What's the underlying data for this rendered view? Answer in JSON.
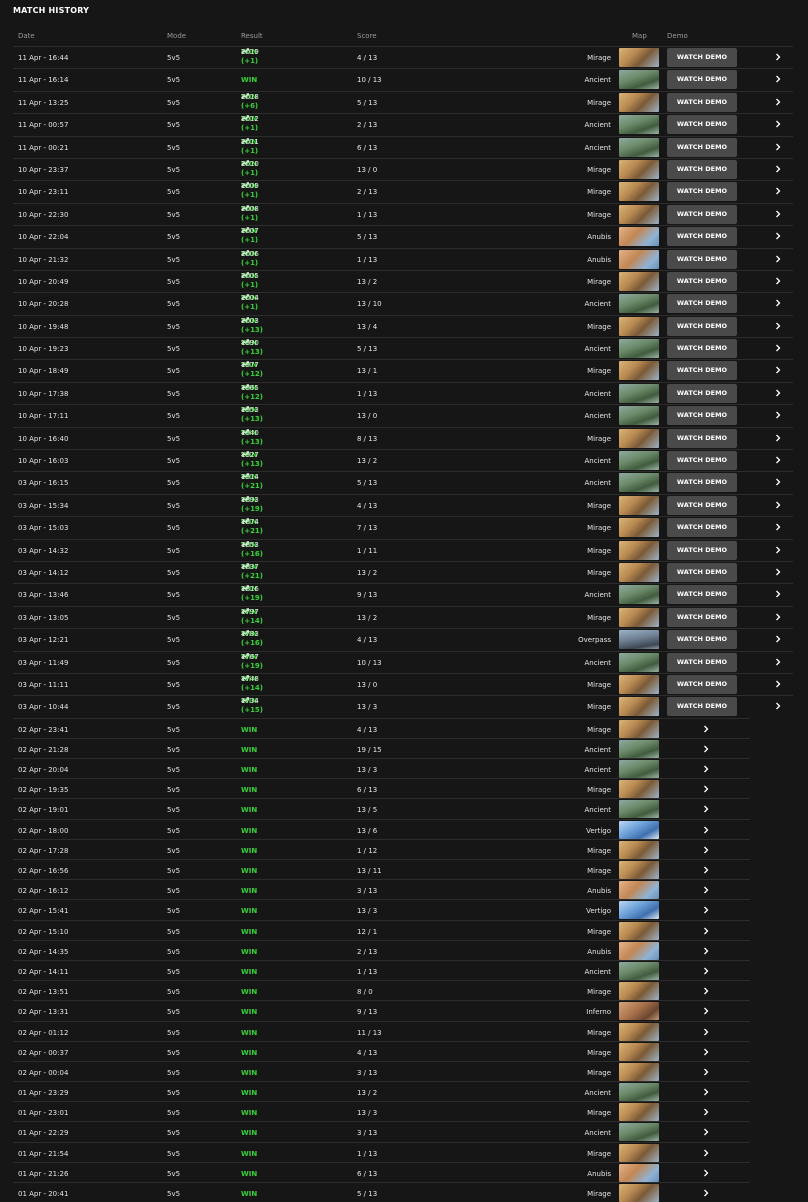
{
  "title": "MATCH HISTORY",
  "columns": {
    "date": "Date",
    "mode": "Mode",
    "result": "Result",
    "score": "Score",
    "map": "Map",
    "demo": "Demo"
  },
  "demo_label": "WATCH DEMO",
  "colors": {
    "win": "#3ad13a",
    "button_bg": "#4a4a4a",
    "background": "#161616"
  },
  "icons": {
    "elo": "trend-up-icon",
    "arrow": "chevron-right-icon"
  },
  "matches": [
    {
      "date": "11 Apr - 16:44",
      "mode": "5v5",
      "result": "WIN (+1)",
      "elo": "2019",
      "score": "4 / 13",
      "map": "Mirage",
      "demo": true
    },
    {
      "date": "11 Apr - 16:14",
      "mode": "5v5",
      "result": "WIN",
      "elo": "",
      "score": "10 / 13",
      "map": "Ancient",
      "demo": true
    },
    {
      "date": "11 Apr - 13:25",
      "mode": "5v5",
      "result": "WIN (+6)",
      "elo": "2018",
      "score": "5 / 13",
      "map": "Mirage",
      "demo": true
    },
    {
      "date": "11 Apr - 00:57",
      "mode": "5v5",
      "result": "WIN (+1)",
      "elo": "2012",
      "score": "2 / 13",
      "map": "Ancient",
      "demo": true
    },
    {
      "date": "11 Apr - 00:21",
      "mode": "5v5",
      "result": "WIN (+1)",
      "elo": "2011",
      "score": "6 / 13",
      "map": "Ancient",
      "demo": true
    },
    {
      "date": "10 Apr - 23:37",
      "mode": "5v5",
      "result": "WIN (+1)",
      "elo": "2010",
      "score": "13 / 0",
      "map": "Mirage",
      "demo": true
    },
    {
      "date": "10 Apr - 23:11",
      "mode": "5v5",
      "result": "WIN (+1)",
      "elo": "2009",
      "score": "2 / 13",
      "map": "Mirage",
      "demo": true
    },
    {
      "date": "10 Apr - 22:30",
      "mode": "5v5",
      "result": "WIN (+1)",
      "elo": "2008",
      "score": "1 / 13",
      "map": "Mirage",
      "demo": true
    },
    {
      "date": "10 Apr - 22:04",
      "mode": "5v5",
      "result": "WIN (+1)",
      "elo": "2007",
      "score": "5 / 13",
      "map": "Anubis",
      "demo": true
    },
    {
      "date": "10 Apr - 21:32",
      "mode": "5v5",
      "result": "WIN (+1)",
      "elo": "2006",
      "score": "1 / 13",
      "map": "Anubis",
      "demo": true
    },
    {
      "date": "10 Apr - 20:49",
      "mode": "5v5",
      "result": "WIN (+1)",
      "elo": "2005",
      "score": "13 / 2",
      "map": "Mirage",
      "demo": true
    },
    {
      "date": "10 Apr - 20:28",
      "mode": "5v5",
      "result": "WIN (+1)",
      "elo": "2004",
      "score": "13 / 10",
      "map": "Ancient",
      "demo": true
    },
    {
      "date": "10 Apr - 19:48",
      "mode": "5v5",
      "result": "WIN (+13)",
      "elo": "2003",
      "score": "13 / 4",
      "map": "Mirage",
      "demo": true
    },
    {
      "date": "10 Apr - 19:23",
      "mode": "5v5",
      "result": "WIN (+13)",
      "elo": "1990",
      "score": "5 / 13",
      "map": "Ancient",
      "demo": true
    },
    {
      "date": "10 Apr - 18:49",
      "mode": "5v5",
      "result": "WIN (+12)",
      "elo": "1977",
      "score": "13 / 1",
      "map": "Mirage",
      "demo": true
    },
    {
      "date": "10 Apr - 17:38",
      "mode": "5v5",
      "result": "WIN (+12)",
      "elo": "1965",
      "score": "1 / 13",
      "map": "Ancient",
      "demo": true
    },
    {
      "date": "10 Apr - 17:11",
      "mode": "5v5",
      "result": "WIN (+13)",
      "elo": "1953",
      "score": "13 / 0",
      "map": "Ancient",
      "demo": true
    },
    {
      "date": "10 Apr - 16:40",
      "mode": "5v5",
      "result": "WIN (+13)",
      "elo": "1940",
      "score": "8 / 13",
      "map": "Mirage",
      "demo": true
    },
    {
      "date": "10 Apr - 16:03",
      "mode": "5v5",
      "result": "WIN (+13)",
      "elo": "1927",
      "score": "13 / 2",
      "map": "Ancient",
      "demo": true
    },
    {
      "date": "03 Apr - 16:15",
      "mode": "5v5",
      "result": "WIN (+21)",
      "elo": "1914",
      "score": "5 / 13",
      "map": "Ancient",
      "demo": true
    },
    {
      "date": "03 Apr - 15:34",
      "mode": "5v5",
      "result": "WIN (+19)",
      "elo": "1893",
      "score": "4 / 13",
      "map": "Mirage",
      "demo": true
    },
    {
      "date": "03 Apr - 15:03",
      "mode": "5v5",
      "result": "WIN (+21)",
      "elo": "1874",
      "score": "7 / 13",
      "map": "Mirage",
      "demo": true
    },
    {
      "date": "03 Apr - 14:32",
      "mode": "5v5",
      "result": "WIN (+16)",
      "elo": "1853",
      "score": "1 / 11",
      "map": "Mirage",
      "demo": true
    },
    {
      "date": "03 Apr - 14:12",
      "mode": "5v5",
      "result": "WIN (+21)",
      "elo": "1837",
      "score": "13 / 2",
      "map": "Mirage",
      "demo": true
    },
    {
      "date": "03 Apr - 13:46",
      "mode": "5v5",
      "result": "WIN (+19)",
      "elo": "1816",
      "score": "9 / 13",
      "map": "Ancient",
      "demo": true
    },
    {
      "date": "03 Apr - 13:05",
      "mode": "5v5",
      "result": "WIN (+14)",
      "elo": "1797",
      "score": "13 / 2",
      "map": "Mirage",
      "demo": true
    },
    {
      "date": "03 Apr - 12:21",
      "mode": "5v5",
      "result": "WIN (+16)",
      "elo": "1783",
      "score": "4 / 13",
      "map": "Overpass",
      "demo": true
    },
    {
      "date": "03 Apr - 11:49",
      "mode": "5v5",
      "result": "WIN (+19)",
      "elo": "1767",
      "score": "10 / 13",
      "map": "Ancient",
      "demo": true
    },
    {
      "date": "03 Apr - 11:11",
      "mode": "5v5",
      "result": "WIN (+14)",
      "elo": "1748",
      "score": "13 / 0",
      "map": "Mirage",
      "demo": true
    },
    {
      "date": "03 Apr - 10:44",
      "mode": "5v5",
      "result": "WIN (+15)",
      "elo": "1734",
      "score": "13 / 3",
      "map": "Mirage",
      "demo": true
    },
    {
      "date": "02 Apr - 23:41",
      "mode": "5v5",
      "result": "WIN",
      "elo": "",
      "score": "4 / 13",
      "map": "Mirage",
      "demo": false
    },
    {
      "date": "02 Apr - 21:28",
      "mode": "5v5",
      "result": "WIN",
      "elo": "",
      "score": "19 / 15",
      "map": "Ancient",
      "demo": false
    },
    {
      "date": "02 Apr - 20:04",
      "mode": "5v5",
      "result": "WIN",
      "elo": "",
      "score": "13 / 3",
      "map": "Ancient",
      "demo": false
    },
    {
      "date": "02 Apr - 19:35",
      "mode": "5v5",
      "result": "WIN",
      "elo": "",
      "score": "6 / 13",
      "map": "Mirage",
      "demo": false
    },
    {
      "date": "02 Apr - 19:01",
      "mode": "5v5",
      "result": "WIN",
      "elo": "",
      "score": "13 / 5",
      "map": "Ancient",
      "demo": false
    },
    {
      "date": "02 Apr - 18:00",
      "mode": "5v5",
      "result": "WIN",
      "elo": "",
      "score": "13 / 6",
      "map": "Vertigo",
      "demo": false
    },
    {
      "date": "02 Apr - 17:28",
      "mode": "5v5",
      "result": "WIN",
      "elo": "",
      "score": "1 / 12",
      "map": "Mirage",
      "demo": false
    },
    {
      "date": "02 Apr - 16:56",
      "mode": "5v5",
      "result": "WIN",
      "elo": "",
      "score": "13 / 11",
      "map": "Mirage",
      "demo": false
    },
    {
      "date": "02 Apr - 16:12",
      "mode": "5v5",
      "result": "WIN",
      "elo": "",
      "score": "3 / 13",
      "map": "Anubis",
      "demo": false
    },
    {
      "date": "02 Apr - 15:41",
      "mode": "5v5",
      "result": "WIN",
      "elo": "",
      "score": "13 / 3",
      "map": "Vertigo",
      "demo": false
    },
    {
      "date": "02 Apr - 15:10",
      "mode": "5v5",
      "result": "WIN",
      "elo": "",
      "score": "12 / 1",
      "map": "Mirage",
      "demo": false
    },
    {
      "date": "02 Apr - 14:35",
      "mode": "5v5",
      "result": "WIN",
      "elo": "",
      "score": "2 / 13",
      "map": "Anubis",
      "demo": false
    },
    {
      "date": "02 Apr - 14:11",
      "mode": "5v5",
      "result": "WIN",
      "elo": "",
      "score": "1 / 13",
      "map": "Ancient",
      "demo": false
    },
    {
      "date": "02 Apr - 13:51",
      "mode": "5v5",
      "result": "WIN",
      "elo": "",
      "score": "8 / 0",
      "map": "Mirage",
      "demo": false
    },
    {
      "date": "02 Apr - 13:31",
      "mode": "5v5",
      "result": "WIN",
      "elo": "",
      "score": "9 / 13",
      "map": "Inferno",
      "demo": false
    },
    {
      "date": "02 Apr - 01:12",
      "mode": "5v5",
      "result": "WIN",
      "elo": "",
      "score": "11 / 13",
      "map": "Mirage",
      "demo": false
    },
    {
      "date": "02 Apr - 00:37",
      "mode": "5v5",
      "result": "WIN",
      "elo": "",
      "score": "4 / 13",
      "map": "Mirage",
      "demo": false
    },
    {
      "date": "02 Apr - 00:04",
      "mode": "5v5",
      "result": "WIN",
      "elo": "",
      "score": "3 / 13",
      "map": "Mirage",
      "demo": false
    },
    {
      "date": "01 Apr - 23:29",
      "mode": "5v5",
      "result": "WIN",
      "elo": "",
      "score": "13 / 2",
      "map": "Ancient",
      "demo": false
    },
    {
      "date": "01 Apr - 23:01",
      "mode": "5v5",
      "result": "WIN",
      "elo": "",
      "score": "13 / 3",
      "map": "Mirage",
      "demo": false
    },
    {
      "date": "01 Apr - 22:29",
      "mode": "5v5",
      "result": "WIN",
      "elo": "",
      "score": "3 / 13",
      "map": "Ancient",
      "demo": false
    },
    {
      "date": "01 Apr - 21:54",
      "mode": "5v5",
      "result": "WIN",
      "elo": "",
      "score": "1 / 13",
      "map": "Mirage",
      "demo": false
    },
    {
      "date": "01 Apr - 21:26",
      "mode": "5v5",
      "result": "WIN",
      "elo": "",
      "score": "6 / 13",
      "map": "Anubis",
      "demo": false
    },
    {
      "date": "01 Apr - 20:41",
      "mode": "5v5",
      "result": "WIN",
      "elo": "",
      "score": "5 / 13",
      "map": "Mirage",
      "demo": false
    }
  ]
}
